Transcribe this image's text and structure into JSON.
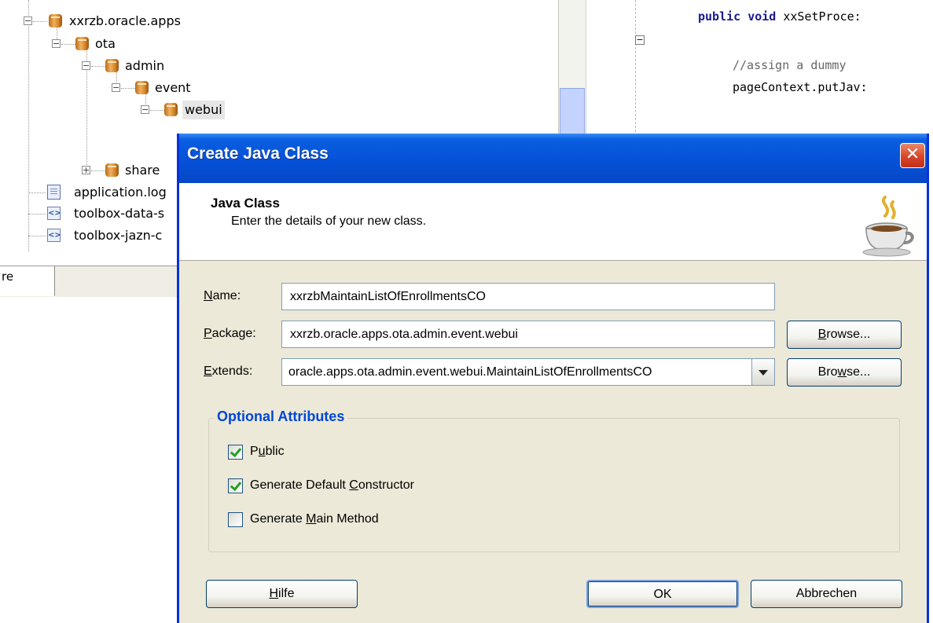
{
  "tree": {
    "items": [
      {
        "label": "xxrzb.oracle.apps"
      },
      {
        "label": "ota"
      },
      {
        "label": "admin"
      },
      {
        "label": "event"
      },
      {
        "label": "webui"
      },
      {
        "label": "share"
      },
      {
        "label": "application.log"
      },
      {
        "label": "toolbox-data-s"
      },
      {
        "label": "toolbox-jazn-c"
      }
    ]
  },
  "tabstrip": {
    "tab_label": "re"
  },
  "editor": {
    "line1_kw": "public void",
    "line1_rest": " xxSetProce:",
    "line2": "//assign a dummy",
    "line3": "pageContext.putJav:"
  },
  "dialog": {
    "title": "Create Java Class",
    "header_title": "Java Class",
    "header_subtitle": "Enter the details of your new class.",
    "name_label": {
      "pre": "",
      "u": "N",
      "post": "ame:"
    },
    "package_label": {
      "pre": "",
      "u": "P",
      "post": "ackage:"
    },
    "extends_label": {
      "pre": "",
      "u": "E",
      "post": "xtends:"
    },
    "name_value": "xxrzbMaintainListOfEnrollmentsCO",
    "package_value": "xxrzb.oracle.apps.ota.admin.event.webui",
    "extends_value": "oracle.apps.ota.admin.event.webui.MaintainListOfEnrollmentsCO",
    "browse1": {
      "pre": "",
      "u": "B",
      "post": "rowse..."
    },
    "browse2": {
      "pre": "Bro",
      "u": "w",
      "post": "se..."
    },
    "group_label": "Optional Attributes",
    "cb_public": {
      "pre": "P",
      "u": "u",
      "post": "blic",
      "checked": true
    },
    "cb_ctor": {
      "pre": "Generate Default ",
      "u": "C",
      "post": "onstructor",
      "checked": true
    },
    "cb_main": {
      "pre": "Generate ",
      "u": "M",
      "post": "ain Method",
      "checked": false
    },
    "help_button": {
      "pre": "",
      "u": "H",
      "post": "ilfe"
    },
    "ok_button": "OK",
    "cancel_button": "Abbrechen"
  }
}
